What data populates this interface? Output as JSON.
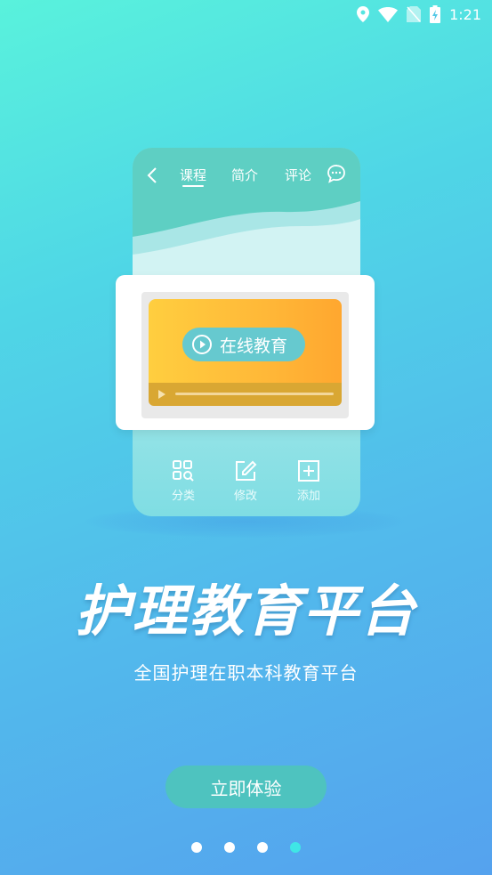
{
  "status_bar": {
    "time": "1:21",
    "icons": [
      "location-icon",
      "wifi-icon",
      "no-sim-icon",
      "battery-charging-icon"
    ]
  },
  "illustration": {
    "tabs": [
      "课程",
      "简介",
      "评论"
    ],
    "video_label": "在线教育",
    "tools": [
      {
        "label": "分类",
        "icon": "grid-search-icon"
      },
      {
        "label": "修改",
        "icon": "edit-icon"
      },
      {
        "label": "添加",
        "icon": "add-box-icon"
      }
    ]
  },
  "headline": "护理教育平台",
  "subtitle": "全国护理在职本科教育平台",
  "cta_label": "立即体验",
  "pager": {
    "total": 4,
    "active_index": 3
  },
  "colors": {
    "accent": "#4ec3bf",
    "active_dot": "#3fe6e6",
    "video_pill": "#66c9cf"
  }
}
